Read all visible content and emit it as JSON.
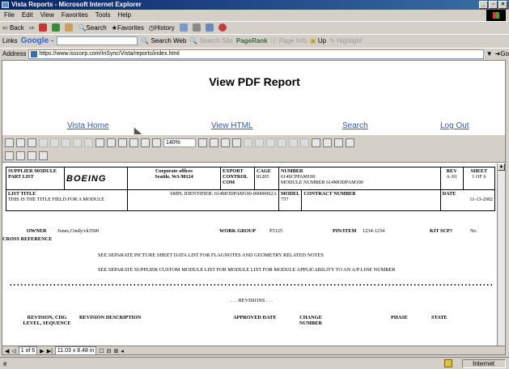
{
  "window": {
    "title": "Vista Reports - Microsoft Internet Explorer",
    "min": "_",
    "max": "▫",
    "close": "×"
  },
  "menu": [
    "File",
    "Edit",
    "View",
    "Favorites",
    "Tools",
    "Help"
  ],
  "toolbar": {
    "back": "Back",
    "search": "Search",
    "favorites": "Favorites",
    "history": "History"
  },
  "linksbar": {
    "links": "Links",
    "google": "Google -",
    "search_web": "Search Web",
    "search_site": "Search Site",
    "pagerank": "PageRank",
    "page_info": "Page Info",
    "up": "Up",
    "highlight": "Highlight"
  },
  "address": {
    "label": "Address",
    "url": "https://www.isscorp.com/InSync/Vista/reports/index.html",
    "go": "Go"
  },
  "page": {
    "title": "View PDF Report",
    "nav": [
      "Vista Home",
      "View HTML",
      "Search",
      "Log Out"
    ]
  },
  "acrobat": {
    "zoom": "140%"
  },
  "pdf": {
    "supplier": "SUPPLIER MODULE PART LIST",
    "logo": "BOEING",
    "corp_line1": "Corporate offices",
    "corp_line2": "Seattle, WA 98124",
    "export": "EXPORT CONTROL COM",
    "cage_label": "CAGE",
    "cage": "81205",
    "number_label": "NUMBER",
    "number_1": "614SCPPAM100",
    "number_2": "MODULE NUMBER 614MODPAM100",
    "rev_label": "REV",
    "rev": "A /01",
    "sheet_label": "SHEET",
    "sheet": "1 OF 6",
    "list_title_label": "LIST TITLE",
    "list_title": "THIS IS THE TITLE FIELD FOR A MODULE",
    "smpl": "SMPL IDENTIFIER: 614MODPAM100-00000062A",
    "model_label": "MODEL",
    "model": "757",
    "contract_label": "CONTRACT NUMBER",
    "date_label": "DATE",
    "date": "11-13-2002",
    "owner_label": "OWNER",
    "owner": "Jones,Cindy/ck3500",
    "workgroup_label": "WORK GROUP",
    "workgroup": "P5125",
    "pinitem_label": "PIN/ITEM",
    "pinitem": "1234-1234",
    "kitscp_label": "KIT SCP?",
    "kitscp": "No",
    "cross_ref": "CROSS REFERENCE",
    "note1": "SEE SEPARATE PICTURE SHEET DATA LIST FOR FLAGNOTES AND GEOMETRY RELATED NOTES",
    "note2": "SEE SEPARATE SUPPLIER CUSTOM MODULE LIST FOR MODULE LIST FOR MODULE APPLICABILITY TO AN A/P LINE NUMBER",
    "revisions": ". . . REVISIONS . . .",
    "col_rev": "REVISION, CHG LEVEL, SEQUENCE",
    "col_desc": "REVISION DESCRIPTION",
    "col_approved": "APPROVED DATE",
    "col_change": "CHANGE NUMBER",
    "col_phase": "PHASE",
    "col_state": "STATE"
  },
  "pdfstatus": {
    "page": "1 of 6",
    "size": "11.03 x 8.48 in"
  },
  "statusbar": {
    "done": "",
    "zone": "Internet"
  }
}
